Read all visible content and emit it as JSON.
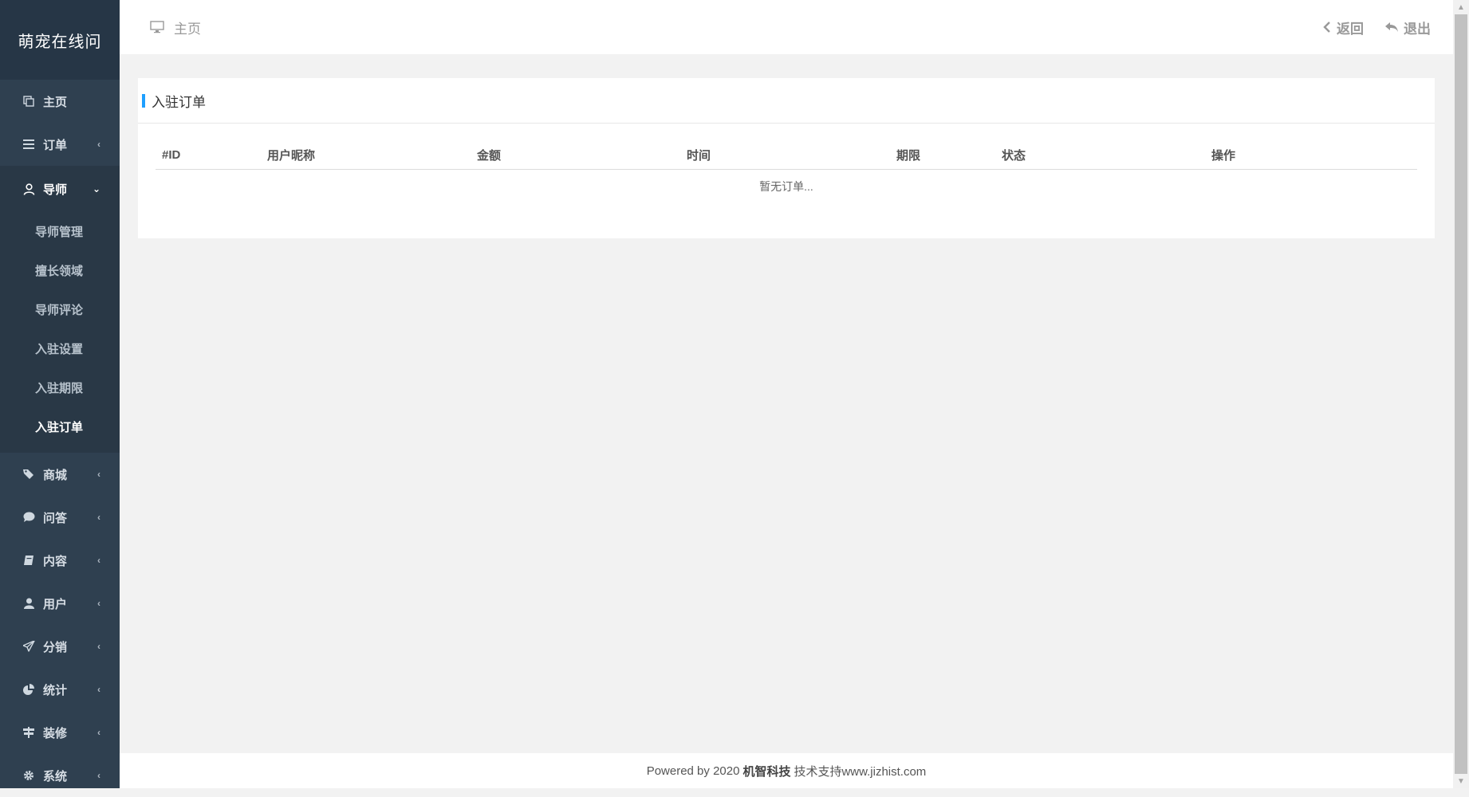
{
  "sidebar": {
    "brand": "萌宠在线问",
    "home": "主页",
    "orders": "订单",
    "mentor": "导师",
    "mentor_sub": [
      "导师管理",
      "擅长领域",
      "导师评论",
      "入驻设置",
      "入驻期限",
      "入驻订单"
    ],
    "rest": [
      "商城",
      "问答",
      "内容",
      "用户",
      "分销",
      "统计",
      "装修",
      "系统"
    ]
  },
  "topbar": {
    "breadcrumb": "主页",
    "back": "返回",
    "logout": "退出"
  },
  "panel": {
    "title": "入驻订单",
    "columns": [
      "#ID",
      "用户昵称",
      "金额",
      "时间",
      "期限",
      "状态",
      "操作"
    ],
    "empty_text": "暂无订单..."
  },
  "footer": {
    "prefix": "Powered by 2020",
    "company": "机智科技",
    "suffix": "技术支持www.jizhist.com"
  },
  "colors": {
    "sidebar_bg": "#2f4050",
    "accent": "#1e9fff",
    "background": "#f2f2f2"
  }
}
